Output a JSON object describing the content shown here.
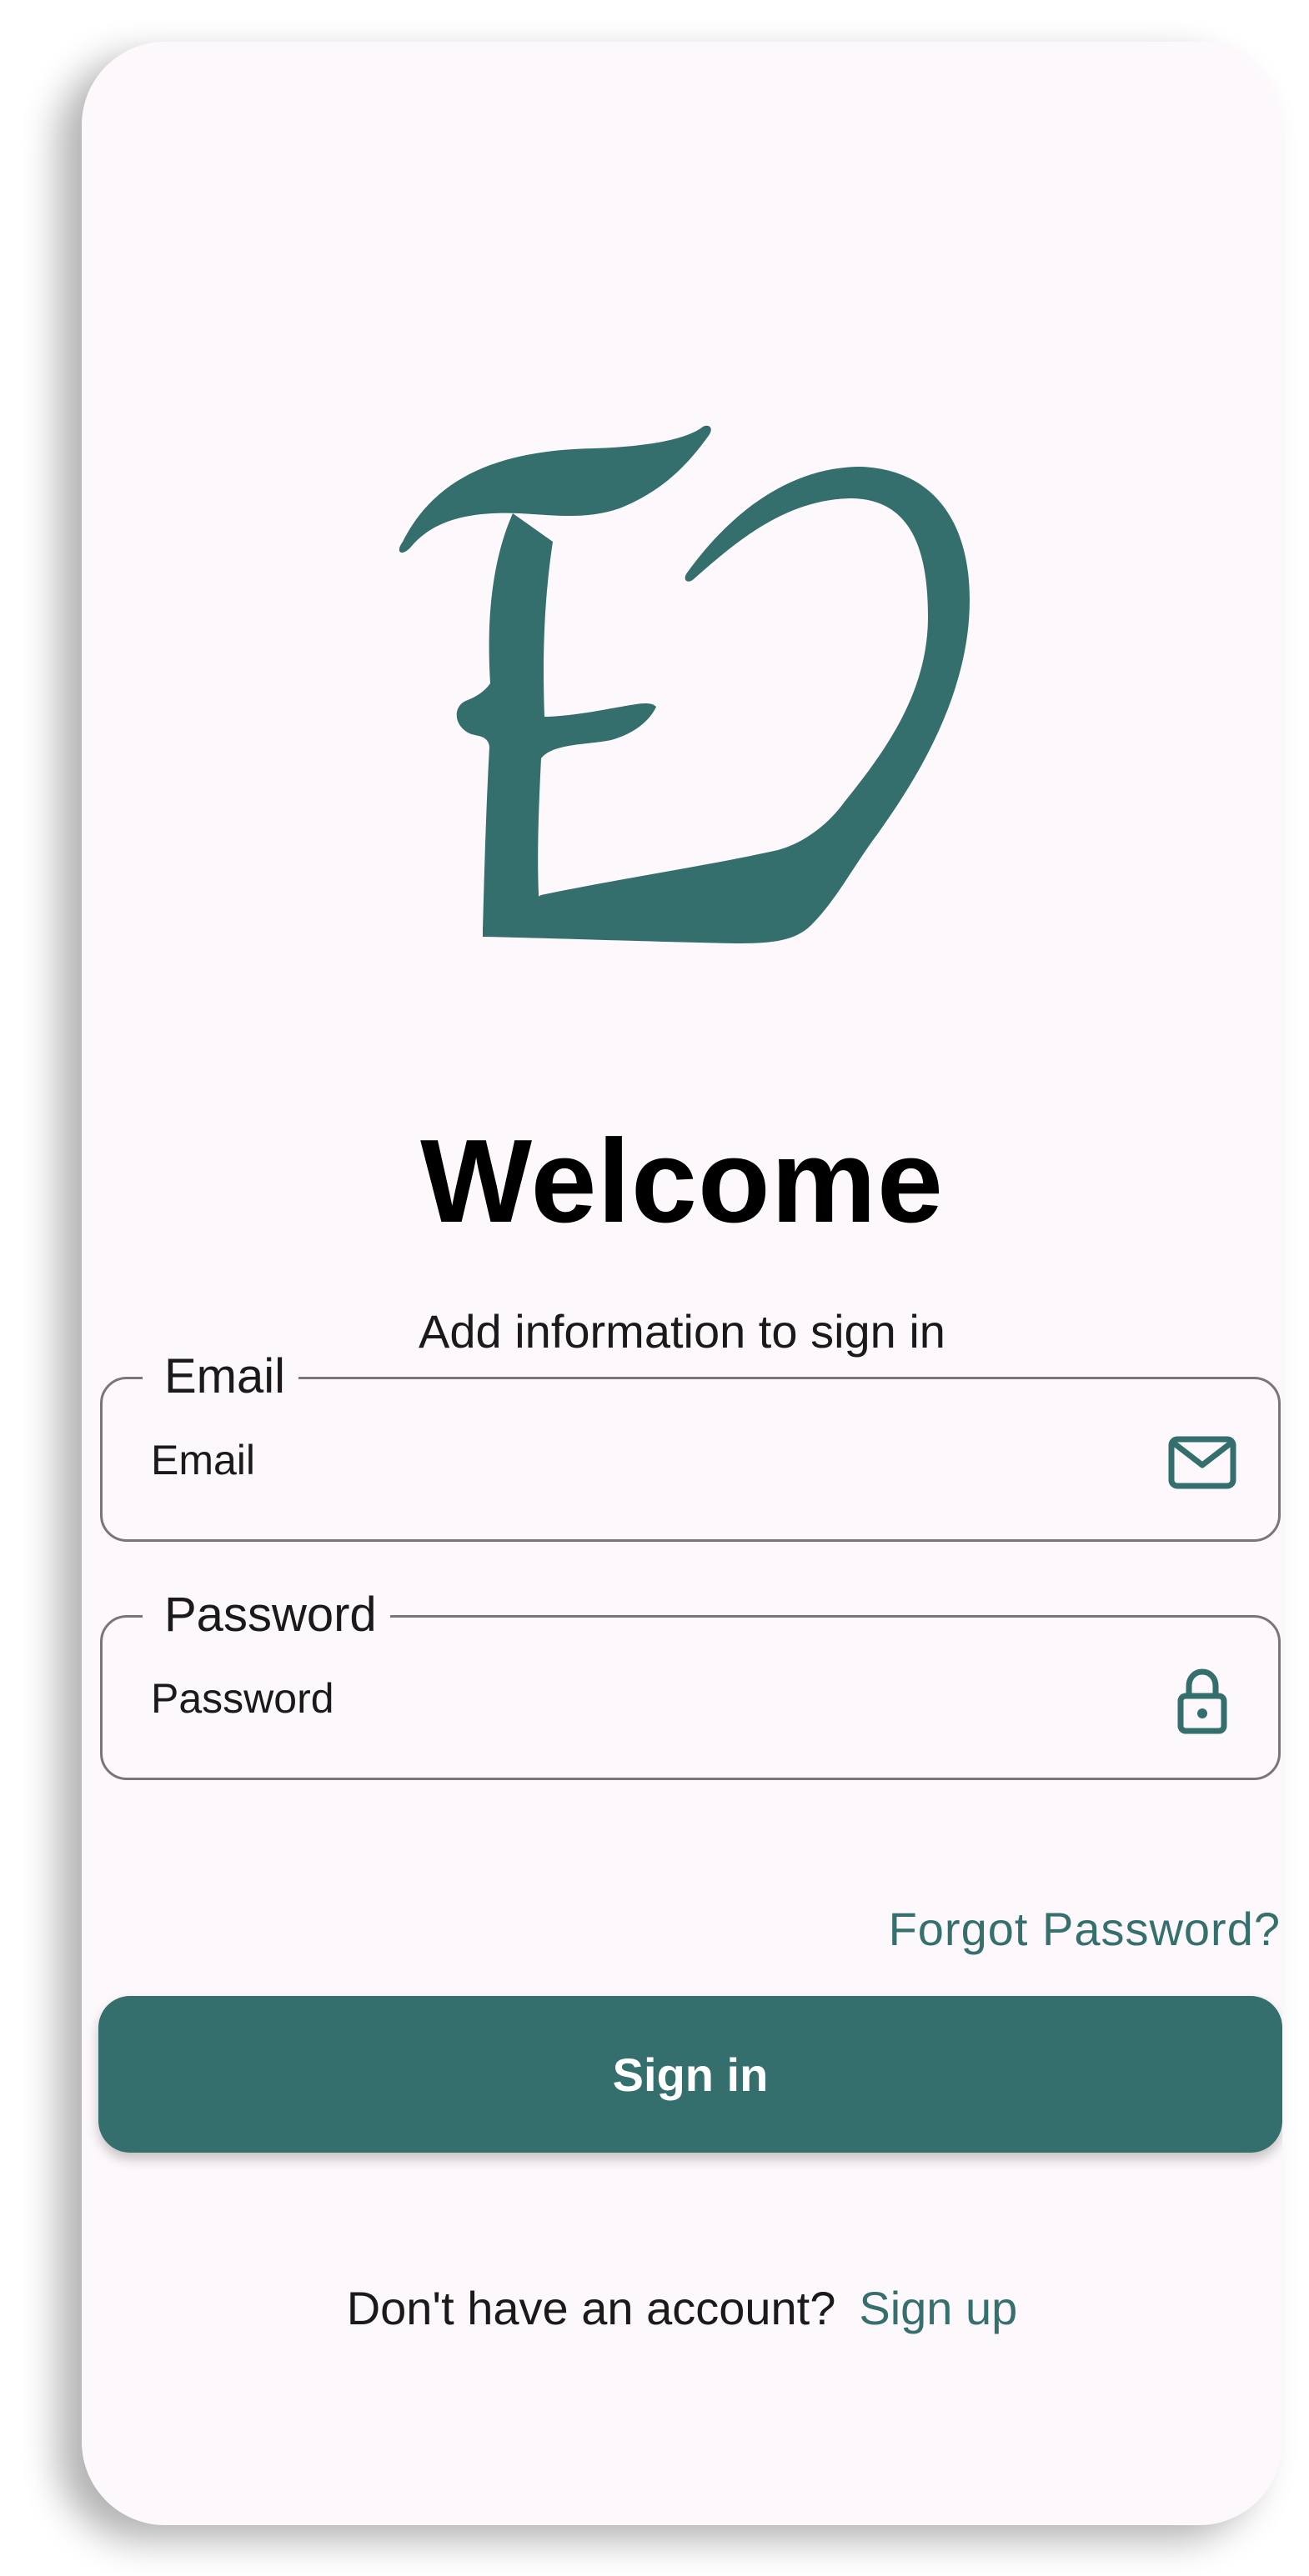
{
  "colors": {
    "accent": "#346f6d",
    "background": "#fdf8fb",
    "outline": "#7a757c"
  },
  "logo": {
    "icon": "ed-monogram-logo"
  },
  "welcome": {
    "title": "Welcome",
    "subtitle": "Add information to sign in"
  },
  "email": {
    "label": "Email",
    "placeholder": "Email",
    "icon": "mail-icon"
  },
  "password": {
    "label": "Password",
    "placeholder": "Password",
    "icon": "lock-icon"
  },
  "forgot_password": "Forgot Password?",
  "sign_in_button": "Sign in",
  "signup": {
    "prompt": "Don't have an account?",
    "link": "Sign up"
  }
}
